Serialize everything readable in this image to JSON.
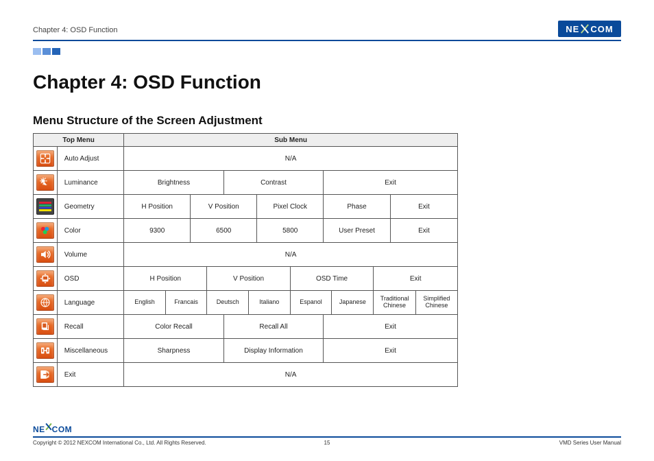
{
  "header": {
    "breadcrumb": "Chapter 4: OSD Function",
    "brand": "NE   COM"
  },
  "title": "Chapter 4: OSD Function",
  "section": "Menu Structure of the Screen Adjustment",
  "table": {
    "head_top": "Top Menu",
    "head_sub": "Sub Menu",
    "rows": [
      {
        "icon": "auto-adjust",
        "label": "Auto Adjust",
        "cells": [
          {
            "text": "N/A",
            "span": 40
          }
        ]
      },
      {
        "icon": "luminance",
        "label": "Luminance",
        "cells": [
          {
            "text": "Brightness",
            "span": 12
          },
          {
            "text": "Contrast",
            "span": 12
          },
          {
            "text": "Exit",
            "span": 16
          }
        ]
      },
      {
        "icon": "geometry",
        "label": "Geometry",
        "cells": [
          {
            "text": "H Position",
            "span": 8
          },
          {
            "text": "V Position",
            "span": 8
          },
          {
            "text": "Pixel Clock",
            "span": 8
          },
          {
            "text": "Phase",
            "span": 8
          },
          {
            "text": "Exit",
            "span": 8
          }
        ]
      },
      {
        "icon": "color",
        "label": "Color",
        "cells": [
          {
            "text": "9300",
            "span": 8
          },
          {
            "text": "6500",
            "span": 8
          },
          {
            "text": "5800",
            "span": 8
          },
          {
            "text": "User Preset",
            "span": 8
          },
          {
            "text": "Exit",
            "span": 8
          }
        ]
      },
      {
        "icon": "volume",
        "label": "Volume",
        "cells": [
          {
            "text": "N/A",
            "span": 40
          }
        ]
      },
      {
        "icon": "osd",
        "label": "OSD",
        "cells": [
          {
            "text": "H Position",
            "span": 10
          },
          {
            "text": "V Position",
            "span": 10
          },
          {
            "text": "OSD Time",
            "span": 10
          },
          {
            "text": "Exit",
            "span": 10
          }
        ]
      },
      {
        "icon": "language",
        "label": "Language",
        "cells": [
          {
            "text": "English",
            "span": 5
          },
          {
            "text": "Francais",
            "span": 5
          },
          {
            "text": "Deutsch",
            "span": 5
          },
          {
            "text": "Italiano",
            "span": 5
          },
          {
            "text": "Espanol",
            "span": 5
          },
          {
            "text": "Japanese",
            "span": 5
          },
          {
            "text": "Traditional Chinese",
            "span": 5
          },
          {
            "text": "Simplified Chinese",
            "span": 5
          }
        ]
      },
      {
        "icon": "recall",
        "label": "Recall",
        "cells": [
          {
            "text": "Color Recall",
            "span": 12
          },
          {
            "text": "Recall All",
            "span": 12
          },
          {
            "text": "Exit",
            "span": 16
          }
        ]
      },
      {
        "icon": "misc",
        "label": "Miscellaneous",
        "cells": [
          {
            "text": "Sharpness",
            "span": 12
          },
          {
            "text": "Display Information",
            "span": 12
          },
          {
            "text": "Exit",
            "span": 16
          }
        ]
      },
      {
        "icon": "exit",
        "label": "Exit",
        "cells": [
          {
            "text": "N/A",
            "span": 40
          }
        ]
      }
    ]
  },
  "footer": {
    "brand": "NEXCOM",
    "copyright": "Copyright © 2012 NEXCOM International Co., Ltd. All Rights Reserved.",
    "page": "15",
    "doc": "VMD Series User Manual"
  }
}
